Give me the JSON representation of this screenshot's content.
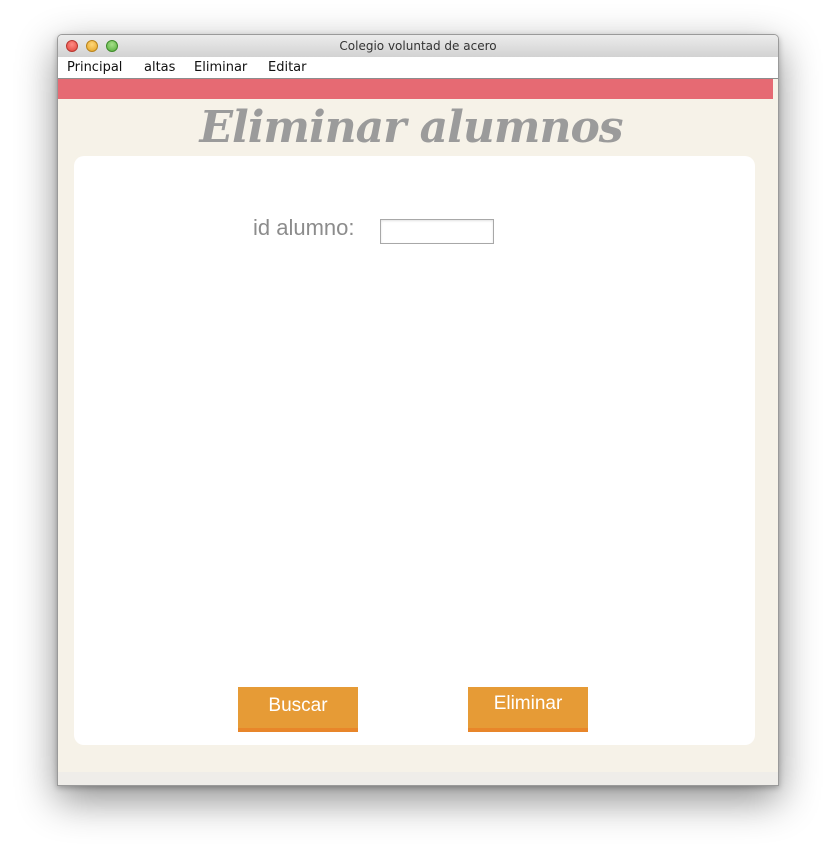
{
  "window": {
    "title": "Colegio voluntad de acero"
  },
  "menu": {
    "items": [
      {
        "label": "Principal"
      },
      {
        "label": "altas"
      },
      {
        "label": "Eliminar"
      },
      {
        "label": "Editar"
      }
    ]
  },
  "page": {
    "title": "Eliminar alumnos"
  },
  "form": {
    "id_label": "id alumno:",
    "id_value": "",
    "id_placeholder": ""
  },
  "buttons": {
    "search_label": "Buscar",
    "delete_label": "Eliminar"
  },
  "colors": {
    "accent_stripe": "#e66a73",
    "button": "#e69b36",
    "background": "#f6f2e8",
    "title_text": "#9b9b9b"
  }
}
